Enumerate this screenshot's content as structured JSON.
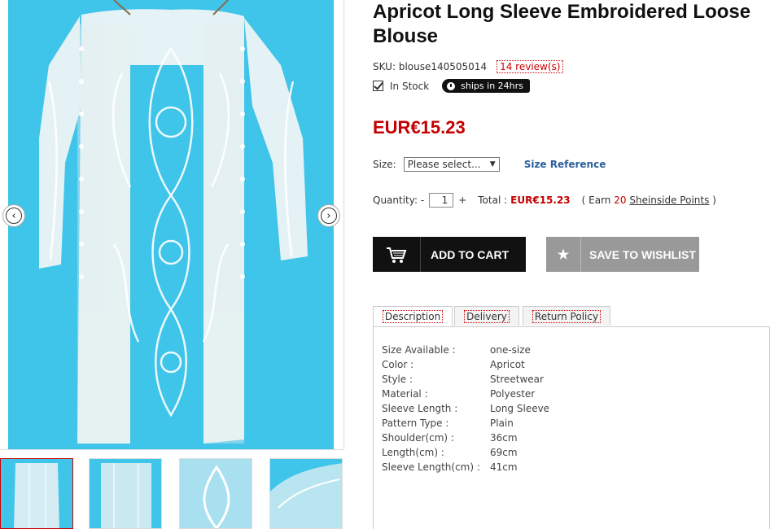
{
  "product": {
    "title": "Apricot Long Sleeve Embroidered Loose Blouse",
    "sku_label": "SKU:",
    "sku": "blouse140505014",
    "reviews_count": "14",
    "reviews_text": " review(s)",
    "stock_text": "In Stock",
    "ship_badge": "ships in 24hrs",
    "price": "EUR€15.23"
  },
  "size": {
    "label": "Size:",
    "selected": "Please select...",
    "reference_link": "Size Reference"
  },
  "quantity": {
    "label": "Quantity:",
    "minus": "-",
    "value": "1",
    "plus": "+",
    "total_label": "Total :",
    "total_value": "EUR€15.23",
    "earn_prefix": "( Earn",
    "earn_points": "20",
    "earn_link": "Sheinside Points",
    "earn_suffix": ")"
  },
  "buttons": {
    "add_to_cart": "ADD TO CART",
    "save_to_wishlist": "SAVE TO WISHLIST"
  },
  "tabs": [
    {
      "label": "Description",
      "active": true
    },
    {
      "label": "Delivery",
      "active": false
    },
    {
      "label": "Return Policy",
      "active": false
    }
  ],
  "specs": [
    {
      "key": "Size Available :",
      "value": "one-size"
    },
    {
      "key": "Color :",
      "value": "Apricot"
    },
    {
      "key": "Style :",
      "value": "Streetwear"
    },
    {
      "key": "Material :",
      "value": "Polyester"
    },
    {
      "key": "Sleeve Length :",
      "value": "Long Sleeve"
    },
    {
      "key": "Pattern Type :",
      "value": "Plain"
    },
    {
      "key": "Shoulder(cm) :",
      "value": "36cm"
    },
    {
      "key": "Length(cm) :",
      "value": "69cm"
    },
    {
      "key": "Sleeve Length(cm) :",
      "value": "41cm"
    }
  ],
  "icons": {
    "prev": "chevron-left-icon",
    "next": "chevron-right-icon",
    "cart": "cart-icon",
    "star": "star-icon",
    "clock": "clock-icon"
  },
  "colors": {
    "price_red": "#c40000",
    "link_blue": "#2a5f9e",
    "image_bg": "#3fc4ea"
  }
}
